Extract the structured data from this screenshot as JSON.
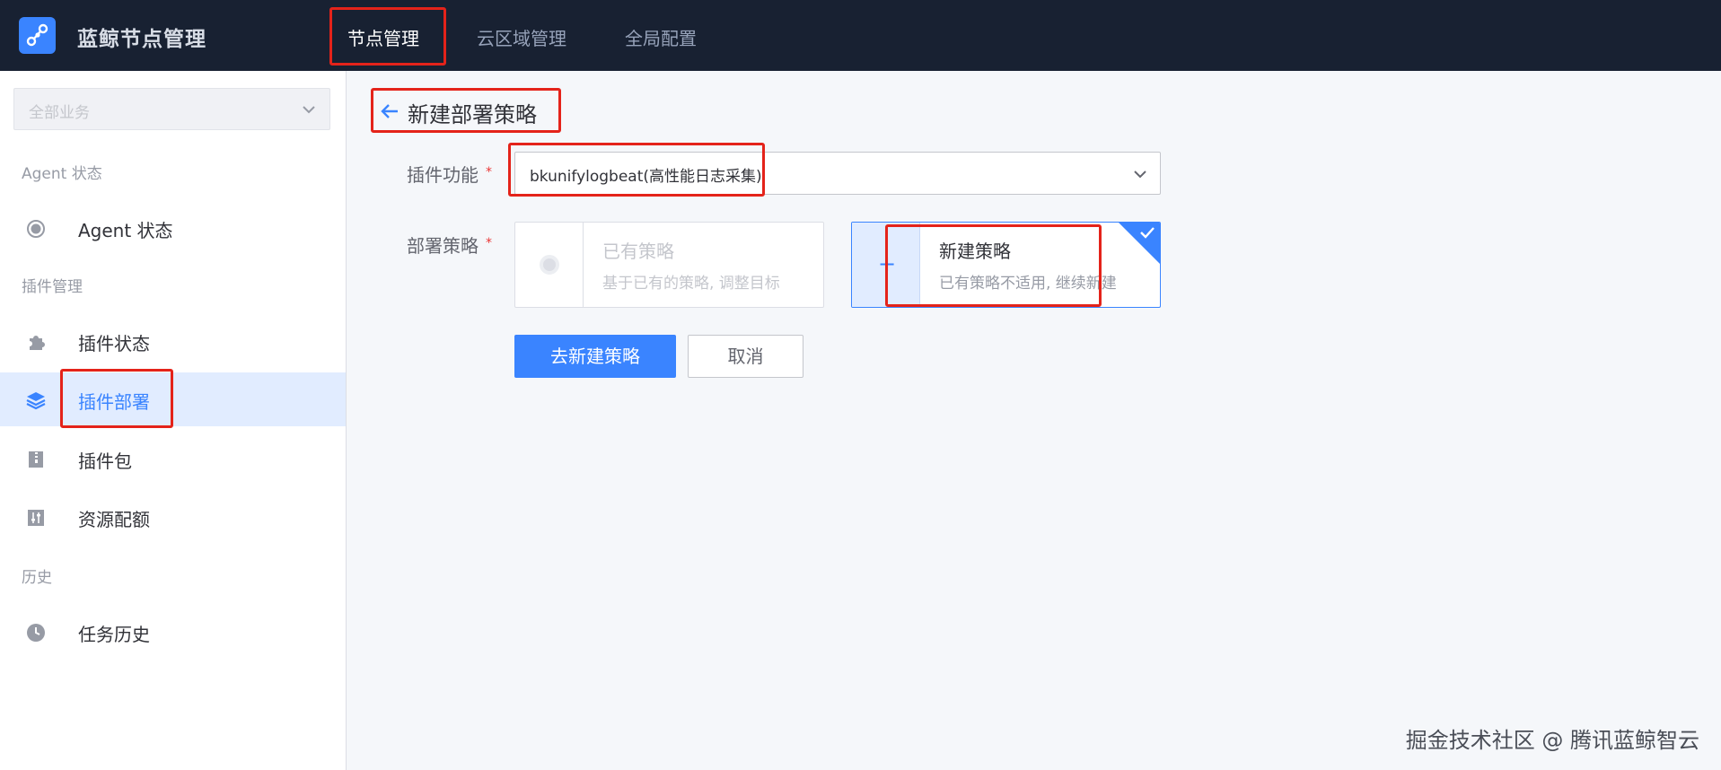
{
  "app": {
    "title": "蓝鲸节点管理",
    "logo_icon": "bk-node-logo-icon"
  },
  "topnav": [
    {
      "label": "节点管理",
      "active": true
    },
    {
      "label": "云区域管理",
      "active": false
    },
    {
      "label": "全局配置",
      "active": false
    }
  ],
  "sidebar": {
    "biz_select": {
      "placeholder": "全部业务"
    },
    "groups": [
      {
        "title": "Agent 状态"
      },
      {
        "title": "插件管理"
      },
      {
        "title": "历史"
      }
    ],
    "items": [
      {
        "label": "Agent 状态",
        "icon": "radio-dot-icon",
        "active": false
      },
      {
        "label": "插件状态",
        "icon": "puzzle-icon",
        "active": false
      },
      {
        "label": "插件部署",
        "icon": "layers-icon",
        "active": true
      },
      {
        "label": "插件包",
        "icon": "package-icon",
        "active": false
      },
      {
        "label": "资源配额",
        "icon": "sliders-icon",
        "active": false
      },
      {
        "label": "任务历史",
        "icon": "clock-icon",
        "active": false
      }
    ]
  },
  "main": {
    "title": "新建部署策略",
    "form": {
      "plugin_label": "插件功能",
      "plugin_value": "bkunifylogbeat(高性能日志采集)",
      "strategy_label": "部署策略",
      "required_mark": "*",
      "options": {
        "existing": {
          "title": "已有策略",
          "desc": "基于已有的策略, 调整目标",
          "selected": false
        },
        "new": {
          "title": "新建策略",
          "desc": "已有策略不适用, 继续新建",
          "selected": true,
          "plus": "+"
        }
      }
    },
    "buttons": {
      "submit": "去新建策略",
      "cancel": "取消"
    }
  },
  "colors": {
    "primary": "#3a84ff",
    "topbar": "#182132",
    "highlight": "#e4231a"
  },
  "watermark": "掘金技术社区 @ 腾讯蓝鲸智云"
}
